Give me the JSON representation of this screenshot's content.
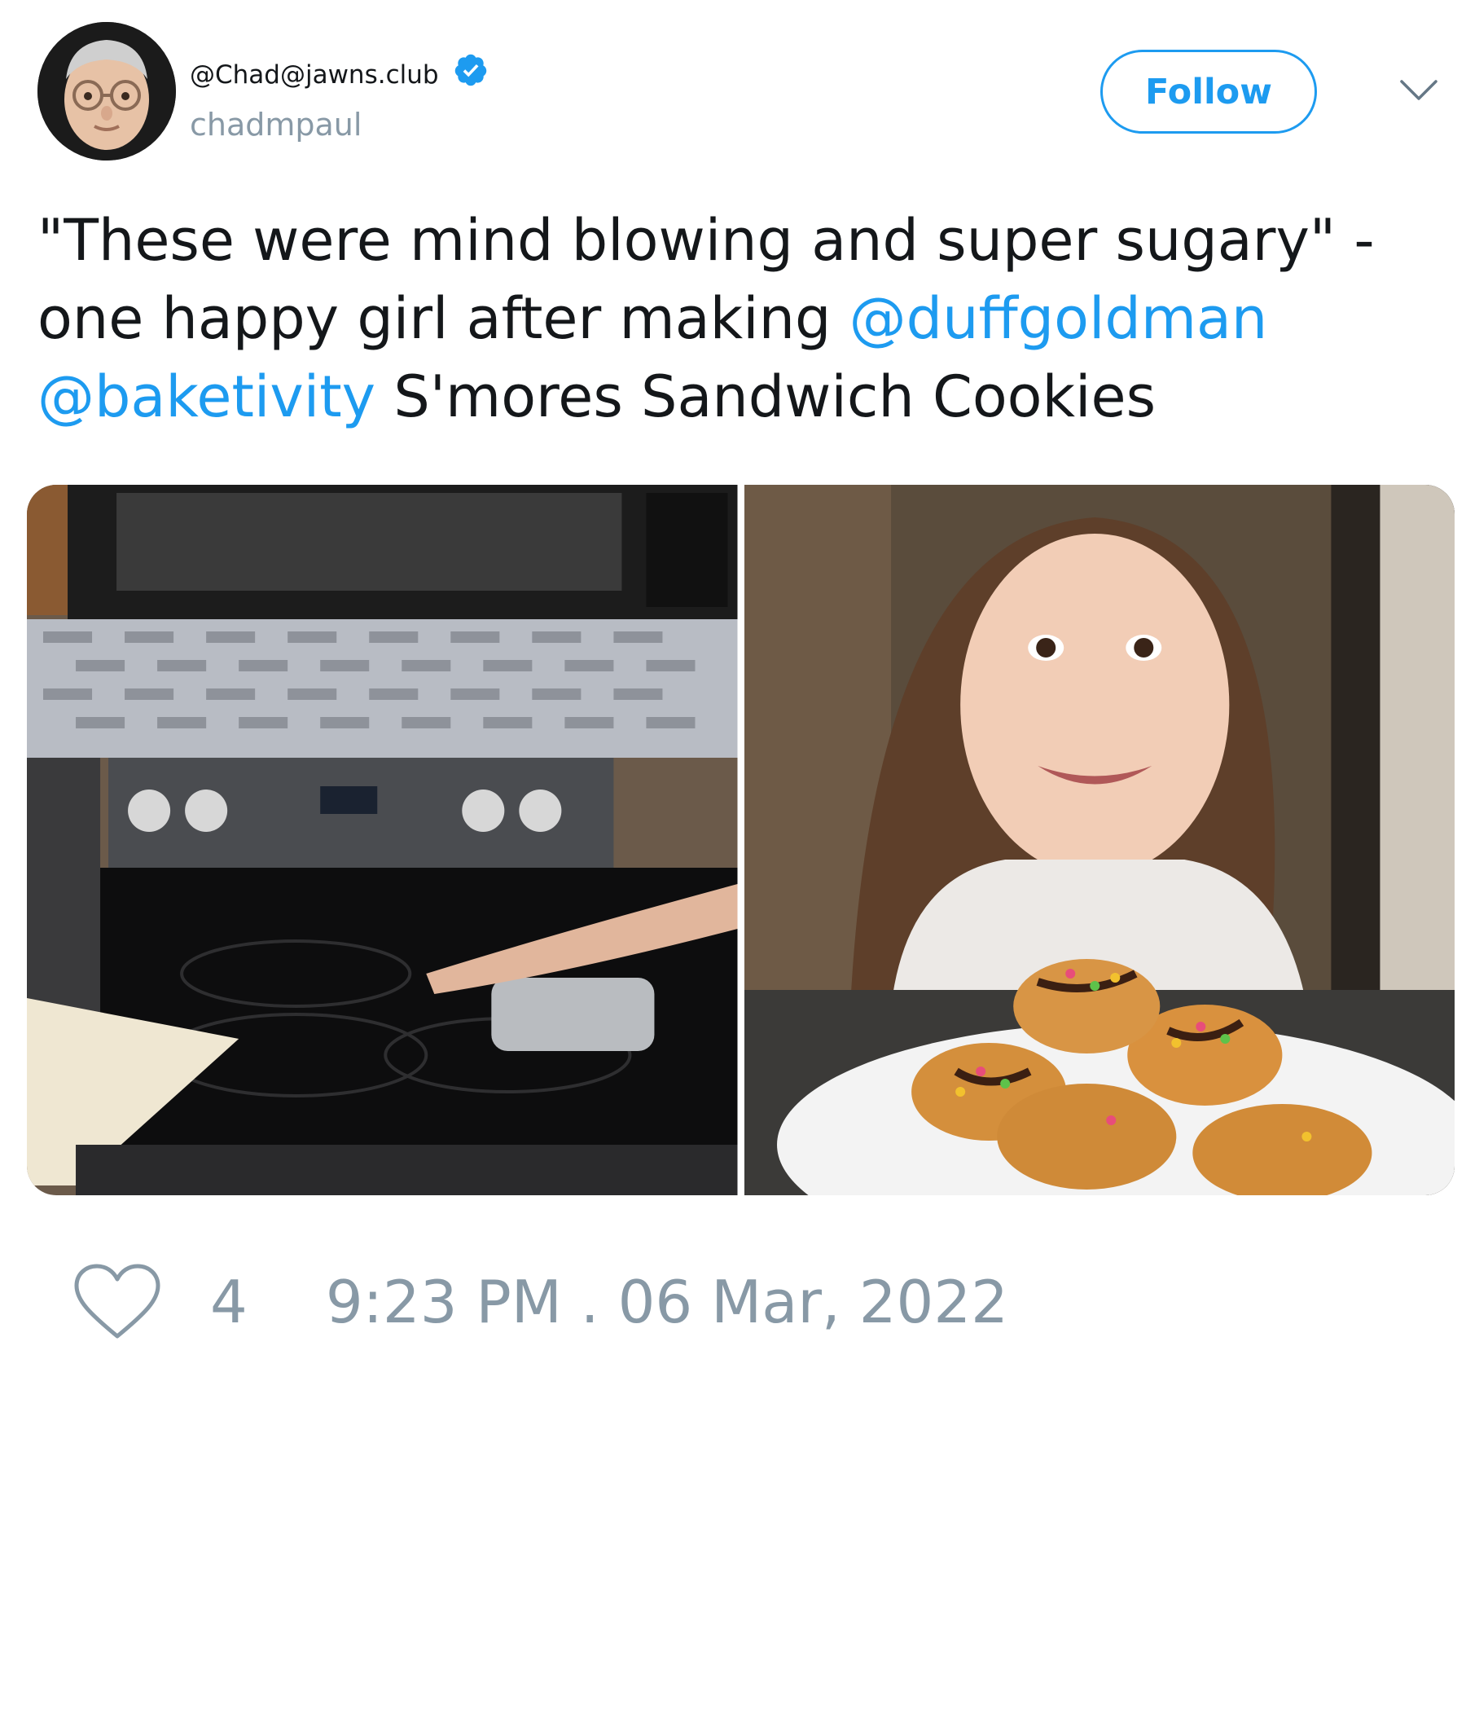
{
  "author": {
    "display_name": "@Chad@jawns.club",
    "username": "chadmpaul",
    "verified": true,
    "avatar_alt": "memoji avatar with glasses"
  },
  "follow_label": "Follow",
  "tweet": {
    "text_part1": "\"These were mind blowing and super sugary\" - one happy girl after making ",
    "mention1": "@duffgoldman",
    "space": " ",
    "mention2": "@baketivity",
    "text_part2": " S'mores Sandwich Cookies"
  },
  "media": [
    {
      "description": "child's arm stirring a pot on a black electric stove"
    },
    {
      "description": "smiling girl behind a plate of s'mores sandwich cookies"
    }
  ],
  "footer": {
    "like_count": "4",
    "timestamp": "9:23 PM . 06 Mar, 2022"
  },
  "colors": {
    "accent": "#1d9bf0",
    "muted": "#8899a6",
    "text": "#14171a"
  },
  "icons": {
    "verified": "verified-badge-icon",
    "chevron": "chevron-down-icon",
    "like": "heart-icon"
  }
}
